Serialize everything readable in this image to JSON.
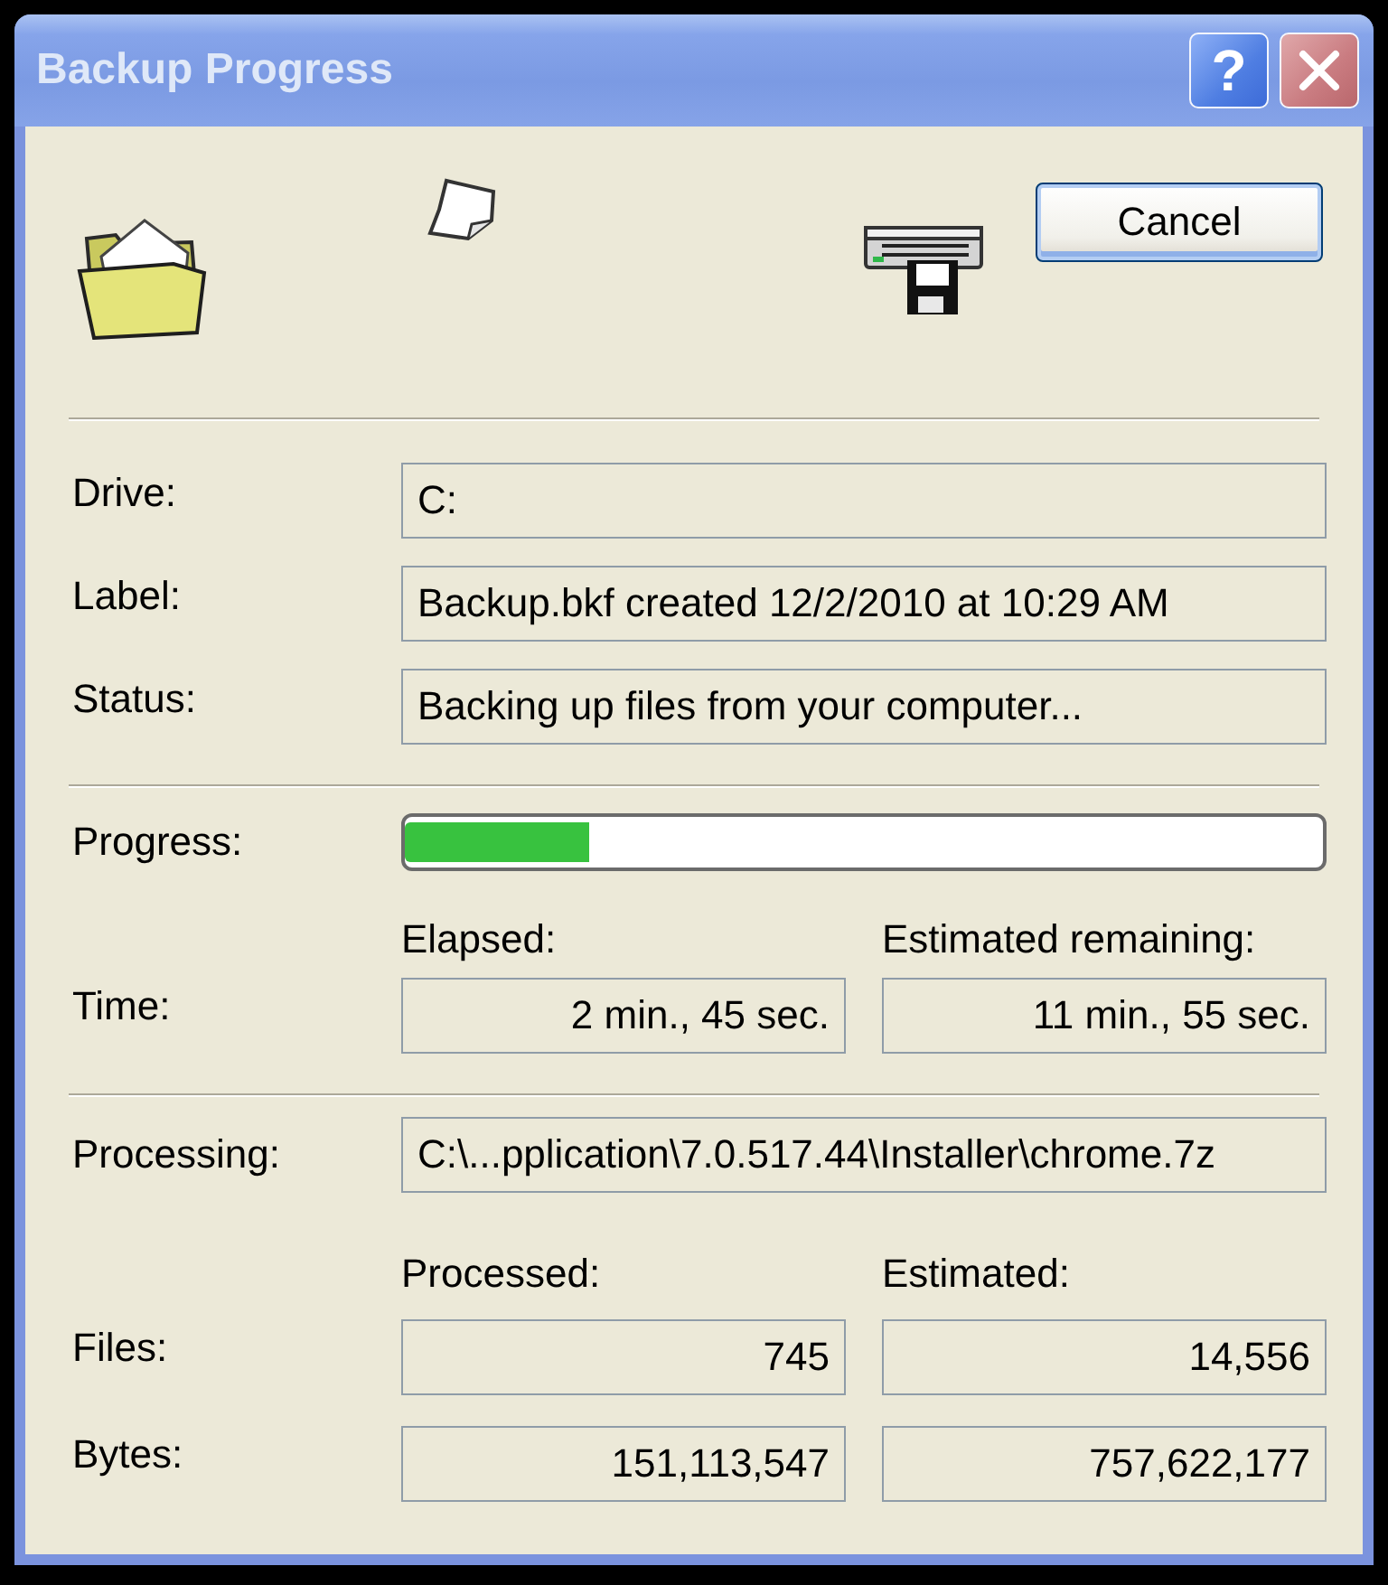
{
  "window": {
    "title": "Backup Progress",
    "help_button": "?"
  },
  "cancel_button": {
    "label": "Cancel"
  },
  "info_fields": [
    {
      "label": "Drive:",
      "value": "C:"
    },
    {
      "label": "Label:",
      "value": "Backup.bkf created 12/2/2010 at 10:29 AM"
    },
    {
      "label": "Status:",
      "value": "Backing up files from your computer..."
    }
  ],
  "progress": {
    "label": "Progress:",
    "level": 0.2
  },
  "time": {
    "label": "Time:",
    "columns": [
      {
        "heading": "Elapsed:",
        "value": "2 min., 45 sec."
      },
      {
        "heading": "Estimated remaining:",
        "value": "11 min., 55 sec."
      }
    ]
  },
  "processing": {
    "label": "Processing:",
    "value": "C:\\...pplication\\7.0.517.44\\Installer\\chrome.7z"
  },
  "counts": {
    "headings": [
      "Processed:",
      "Estimated:"
    ],
    "rows": [
      {
        "label": "Files:",
        "values": [
          "745",
          "14,556"
        ]
      },
      {
        "label": "Bytes:",
        "values": [
          "151,113,547",
          "757,622,177"
        ]
      }
    ]
  }
}
